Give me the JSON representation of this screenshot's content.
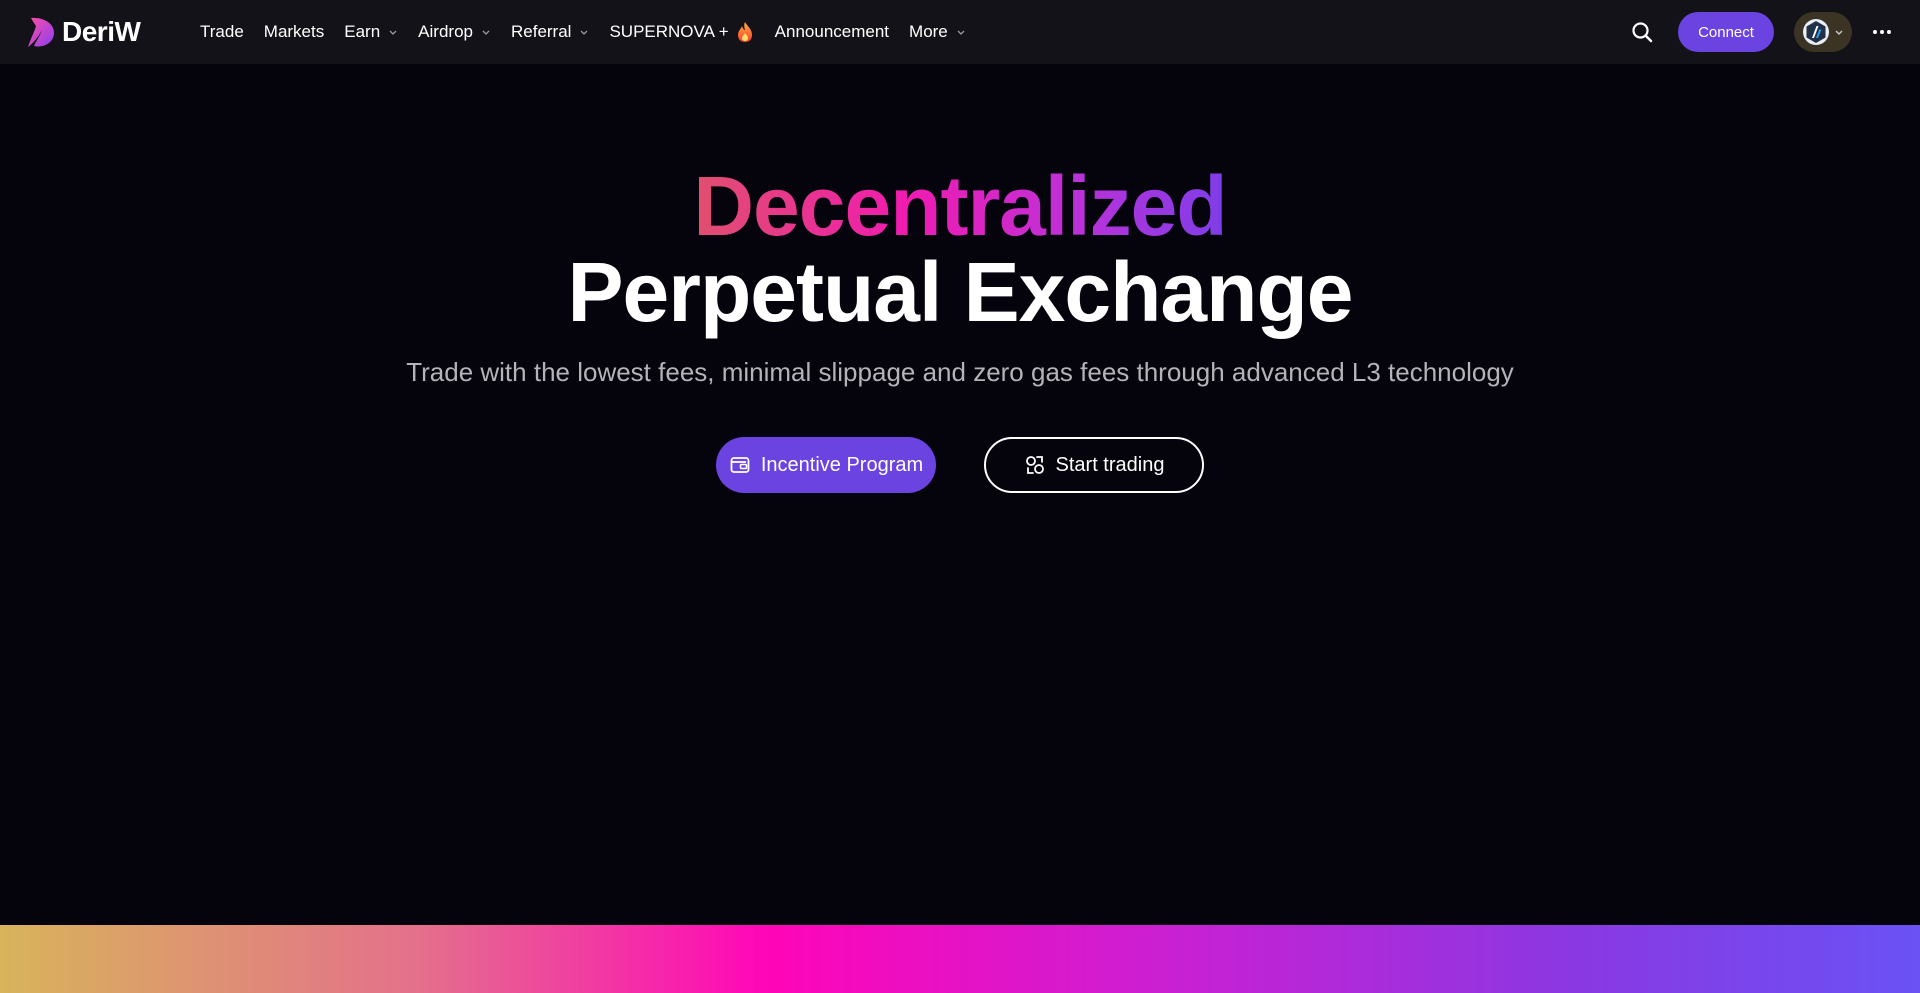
{
  "brand": {
    "name": "DeriW",
    "accent": "#6a43e0"
  },
  "nav": {
    "items": [
      {
        "label": "Trade",
        "dropdown": false
      },
      {
        "label": "Markets",
        "dropdown": false
      },
      {
        "label": "Earn",
        "dropdown": true
      },
      {
        "label": "Airdrop",
        "dropdown": true
      },
      {
        "label": "Referral",
        "dropdown": true
      },
      {
        "label": "SUPERNOVA +",
        "dropdown": false,
        "icon": "flame-icon"
      },
      {
        "label": "Announcement",
        "dropdown": false
      },
      {
        "label": "More",
        "dropdown": true
      }
    ]
  },
  "header": {
    "connect_label": "Connect",
    "search_icon": "search-icon",
    "chain_icon": "arbitrum-icon",
    "menu_icon": "more-dots-icon"
  },
  "hero": {
    "title_line1": "Decentralized",
    "title_line2": "Perpetual Exchange",
    "subtitle": "Trade with the lowest fees, minimal slippage and zero gas fees through advanced L3 technology",
    "primary_button": "Incentive Program",
    "secondary_button": "Start trading"
  }
}
